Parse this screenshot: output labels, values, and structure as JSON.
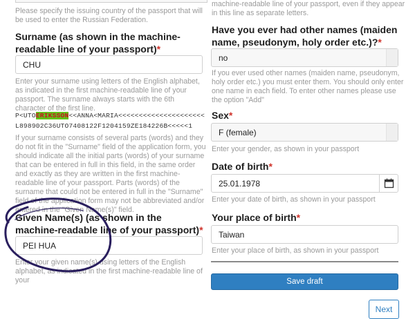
{
  "left": {
    "country_help": "Please specify the issuing country of the passport that will be used to enter the Russian Federation.",
    "surname_label": "Surname (as shown in the machine-readable line of your passport)",
    "required_mark": "*",
    "surname_value": "CHU",
    "surname_help": "Enter your surname using letters of the English alphabet, as indicated in the first machine-readable line of your passport. The surname always starts with the 6th character of the first line.",
    "mrz_line1_pre": "P<UTO",
    "mrz_line1_hl": "ERIKSSON",
    "mrz_line1_post": "<<ANNA<MARIA<<<<<<<<<<<<<<<<<<<<<",
    "mrz_line2": "L898902C36UTO7408122F1204159ZE184226B<<<<<1",
    "parts_help": "If your surname consists of several parts (words) and they do not fit in the \"Surname\" field of the application form, you should indicate all the initial parts (words) of your surname that can be entered in full in this field, in the same order and exactly as they are written in the first machine-readable line of your passport. Parts (words) of the surname that could not be entered in full in the \"Surname\" field of the application form may not be abbreviated and/or entered in the \"Given Name(s)\" field.",
    "given_label": "Given Name(s) (as shown in the machine-readable line of your passport)",
    "given_value": "PEI HUA",
    "given_help": "Enter your given name(s) using letters of the English alphabet, as indicated in the first machine-readable line of your"
  },
  "right": {
    "top_help": "machine-readable line of your passport, even if they appear in this line as separate letters.",
    "other_names_label": "Have you ever had other names (maiden name, pseudonym, holy order etc.)?",
    "other_names_value": "no",
    "other_names_help": "If you ever used other names (maiden name, pseudonym, holy order etc.) you must enter them. You should only enter one name in each field. To enter other names please use the option \"Add\"",
    "sex_label": "Sex",
    "sex_value": "F (female)",
    "sex_help": "Enter your gender, as shown in your passport",
    "dob_label": "Date of birth",
    "dob_value": "25.01.1978",
    "dob_help": "Enter your date of birth, as shown in your passport",
    "pob_label": "Your place of birth",
    "pob_value": "Taiwan",
    "pob_help": "Enter your place of birth, as shown in your passport"
  },
  "buttons": {
    "save_draft": "Save draft",
    "next": "Next"
  },
  "colors": {
    "primary": "#2f7fc1",
    "required": "#d0342c",
    "highlight_bg": "#62c21a",
    "annotation_ink": "#2a1f5e"
  }
}
